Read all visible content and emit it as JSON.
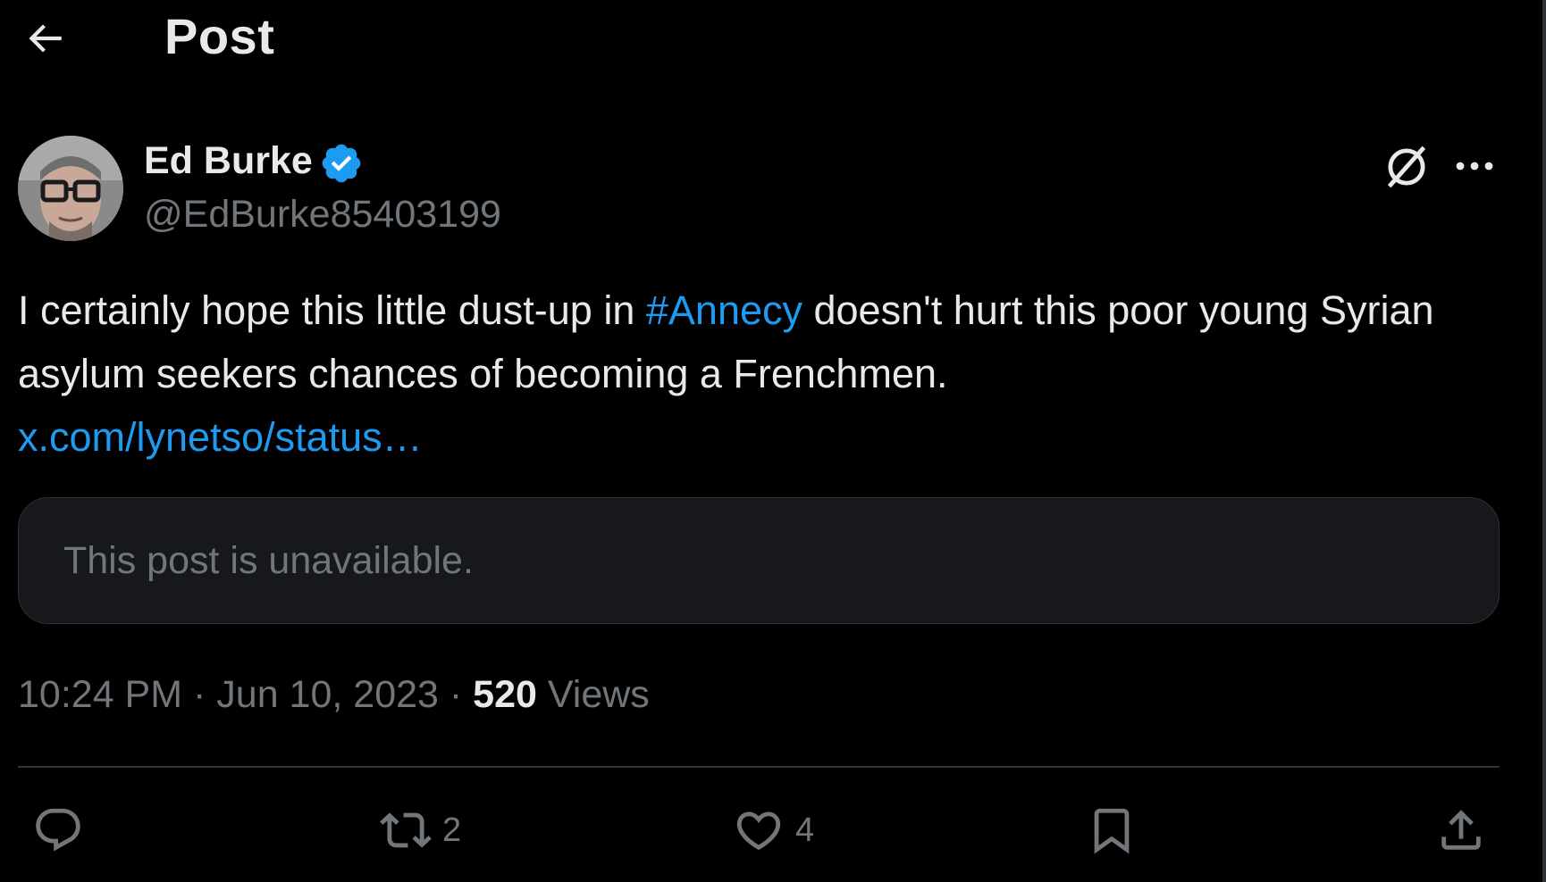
{
  "header": {
    "title": "Post",
    "back_icon": "arrow-left-icon"
  },
  "author": {
    "name": "Ed Burke",
    "handle": "@EdBurke85403199",
    "verified": true,
    "verified_color": "#1d9bf0"
  },
  "post": {
    "text_before": "I certainly hope this little dust-up in ",
    "hashtag": "#Annecy",
    "text_after": " doesn't hurt this poor young Syrian asylum seekers chances of becoming a Frenchmen.",
    "link": "x.com/lynetso/status…",
    "quoted_unavailable": "This post is unavailable."
  },
  "meta": {
    "time": "10:24 PM",
    "separator": " · ",
    "date": "Jun 10, 2023",
    "views_count": "520",
    "views_label": "Views"
  },
  "actions": {
    "reply_count": "",
    "repost_count": "2",
    "like_count": "4"
  },
  "colors": {
    "background": "#000000",
    "text_primary": "#e7e9ea",
    "text_secondary": "#71767b",
    "link": "#1d9bf0",
    "card_background": "#16181c",
    "border": "#2f3336"
  }
}
